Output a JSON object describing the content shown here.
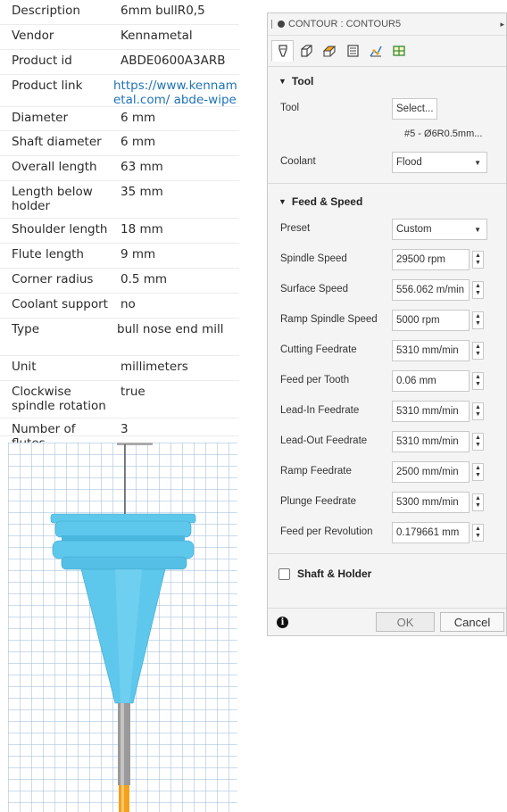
{
  "properties": [
    {
      "label": "Description",
      "value": "6mm bullR0,5"
    },
    {
      "label": "Vendor",
      "value": "Kennametal"
    },
    {
      "label": "Product id",
      "value": "ABDE0600A3ARB"
    },
    {
      "label": "Product link",
      "value": "https://www.kennametal.com/ abde-wiper-facet-extended-n",
      "link": true
    },
    {
      "label": "Diameter",
      "value": "6 mm"
    },
    {
      "label": "Shaft diameter",
      "value": "6 mm"
    },
    {
      "label": "Overall length",
      "value": "63 mm"
    },
    {
      "label": "Length below holder",
      "value": "35 mm"
    },
    {
      "label": "Shoulder length",
      "value": "18 mm"
    },
    {
      "label": "Flute length",
      "value": "9 mm"
    },
    {
      "label": "Corner radius",
      "value": "0.5 mm"
    },
    {
      "label": "Coolant support",
      "value": "no"
    },
    {
      "label": "Type",
      "value": "bull nose end mill"
    },
    {
      "label": "Unit",
      "value": "millimeters"
    },
    {
      "label": "Clockwise spindle rotation",
      "value": "true"
    },
    {
      "label": "Number of flutes",
      "value": "3"
    }
  ],
  "dialog": {
    "title": "CONTOUR : CONTOUR5",
    "tabs": [
      {
        "icon": "tool-icon",
        "active": true
      },
      {
        "icon": "geometry-icon"
      },
      {
        "icon": "heights-icon"
      },
      {
        "icon": "passes-icon"
      },
      {
        "icon": "linking-icon"
      },
      {
        "icon": "post-icon"
      }
    ],
    "tool_section": {
      "header": "Tool",
      "tool_label": "Tool",
      "tool_button": "Select...",
      "tool_id": "#5 - Ø6R0.5mm...",
      "coolant_label": "Coolant",
      "coolant_value": "Flood"
    },
    "feed_section": {
      "header": "Feed & Speed",
      "preset_label": "Preset",
      "preset_value": "Custom",
      "fields": [
        {
          "label": "Spindle Speed",
          "value": "29500 rpm"
        },
        {
          "label": "Surface Speed",
          "value": "556.062 m/min"
        },
        {
          "label": "Ramp Spindle Speed",
          "value": "5000 rpm"
        },
        {
          "label": "Cutting Feedrate",
          "value": "5310 mm/min"
        },
        {
          "label": "Feed per Tooth",
          "value": "0.06 mm"
        },
        {
          "label": "Lead-In Feedrate",
          "value": "5310 mm/min"
        },
        {
          "label": "Lead-Out Feedrate",
          "value": "5310 mm/min"
        },
        {
          "label": "Ramp Feedrate",
          "value": "2500 mm/min"
        },
        {
          "label": "Plunge Feedrate",
          "value": "5300 mm/min"
        },
        {
          "label": "Feed per Revolution",
          "value": "0.179661 mm"
        }
      ]
    },
    "shaft_section": {
      "header": "Shaft & Holder",
      "checked": false
    },
    "footer": {
      "ok": "OK",
      "cancel": "Cancel",
      "info_icon": "info-icon"
    }
  },
  "colors": {
    "holder": "#5ec8ec",
    "tool_shank": "#9a9a9a",
    "tool_flute": "#f2a21c",
    "link": "#1f73b7",
    "grid": "#a0bedc"
  }
}
